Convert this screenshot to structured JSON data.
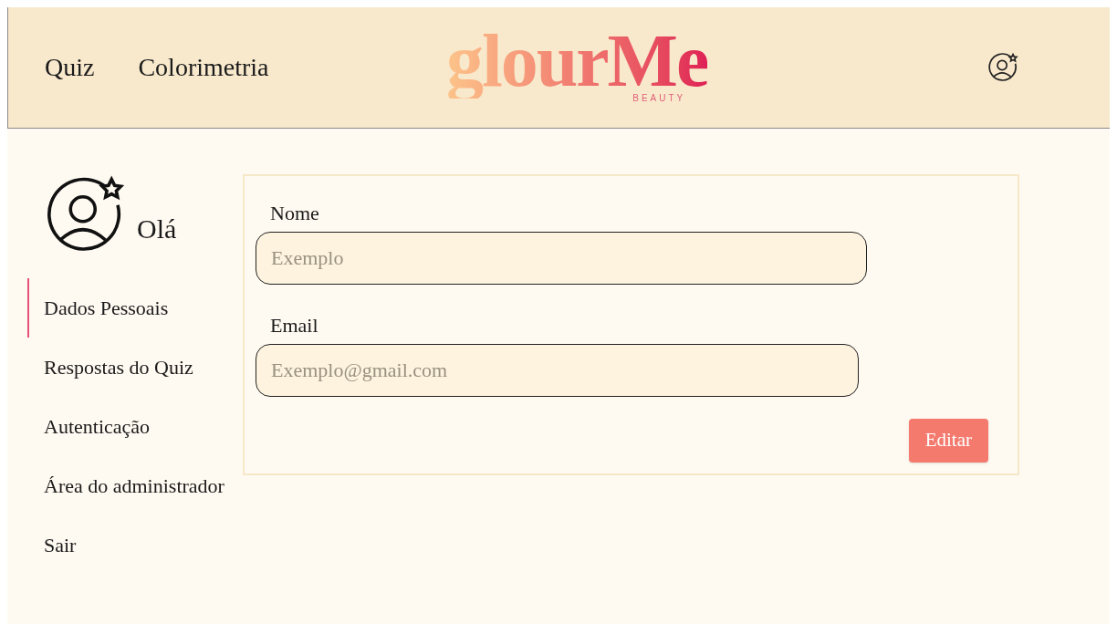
{
  "nav": [
    {
      "label": "Quiz"
    },
    {
      "label": "Colorimetria"
    }
  ],
  "logo": {
    "name": "glourMe",
    "tagline": "BEAUTY"
  },
  "greeting": "Olá",
  "sidebar": {
    "items": [
      {
        "label": "Dados Pessoais",
        "selected": true
      },
      {
        "label": "Respostas do Quiz",
        "selected": false
      },
      {
        "label": "Autenticação",
        "selected": false
      },
      {
        "label": "Área do administrador",
        "selected": false
      },
      {
        "label": "Sair",
        "selected": false
      }
    ]
  },
  "form": {
    "fields": [
      {
        "label": "Nome",
        "placeholder": "Exemplo"
      },
      {
        "label": "Email",
        "placeholder": "Exemplo@gmail.com"
      }
    ],
    "button": "Editar"
  }
}
